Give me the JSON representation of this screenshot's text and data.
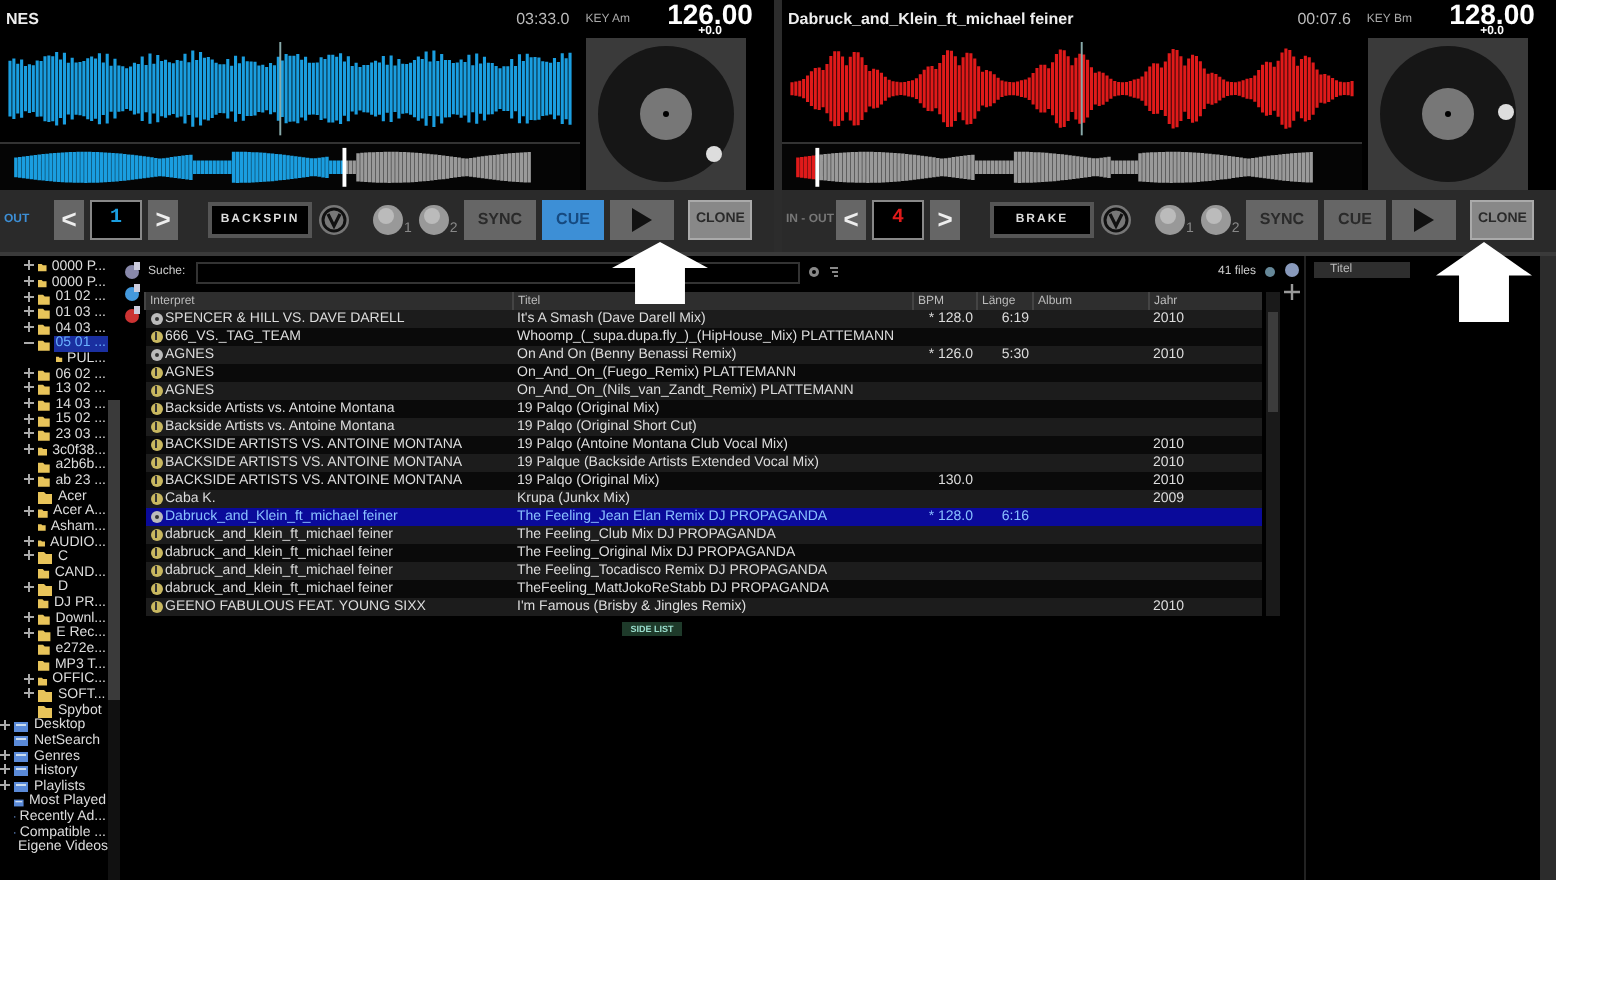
{
  "decks": [
    {
      "title": "NES",
      "time": "03:33.0",
      "key": "KEY Am",
      "bpm": "126.00",
      "pitch": "+0.0",
      "color": "#1a9ee0",
      "level": 0.62,
      "loop_label": "OUT",
      "prev": "<",
      "loop_value": "1",
      "next": ">",
      "effect": "BACKSPIN",
      "knobs": [
        "1",
        "2"
      ],
      "buttons": [
        {
          "kind": "text",
          "label": "SYNC",
          "active": false
        },
        {
          "kind": "text",
          "label": "CUE",
          "active": true
        },
        {
          "kind": "play",
          "active": false
        },
        {
          "kind": "text",
          "label": "CLONE",
          "active": false
        }
      ]
    },
    {
      "title": "Dabruck_and_Klein_ft_michael feiner",
      "time": "00:07.6",
      "key": "KEY Bm",
      "bpm": "128.00",
      "pitch": "+0.0",
      "color": "#e01a1a",
      "level": 0.03,
      "loop_label": "IN - OUT",
      "prev": "<",
      "loop_value": "4",
      "next": ">",
      "effect": "BRAKE",
      "knobs": [
        "1",
        "2"
      ],
      "buttons": [
        {
          "kind": "text",
          "label": "SYNC",
          "active": false
        },
        {
          "kind": "text",
          "label": "CUE",
          "active": false
        },
        {
          "kind": "play",
          "active": false
        },
        {
          "kind": "text",
          "label": "CLONE",
          "active": false
        }
      ]
    }
  ],
  "sidebar": {
    "folders": [
      {
        "label": "0000 P...",
        "kind": "collapsed",
        "selected": false
      },
      {
        "label": "0000 P...",
        "kind": "collapsed",
        "selected": false
      },
      {
        "label": "01 02 ...",
        "kind": "collapsed",
        "selected": false
      },
      {
        "label": "01 03 ...",
        "kind": "collapsed",
        "selected": false
      },
      {
        "label": "04 03 ...",
        "kind": "collapsed",
        "selected": false
      },
      {
        "label": "05 01 ...",
        "kind": "expanded",
        "selected": true,
        "children": [
          {
            "label": "PUL...",
            "selected": false
          }
        ]
      },
      {
        "label": "06 02 ...",
        "kind": "collapsed",
        "selected": false
      },
      {
        "label": "13 02 ...",
        "kind": "collapsed",
        "selected": false
      },
      {
        "label": "14 03 ...",
        "kind": "collapsed",
        "selected": false
      },
      {
        "label": "15 02 ...",
        "kind": "collapsed",
        "selected": false
      },
      {
        "label": "23 03 ...",
        "kind": "collapsed",
        "selected": false
      },
      {
        "label": "3c0f38...",
        "kind": "collapsed",
        "selected": false
      },
      {
        "label": "a2b6b...",
        "kind": "leaf",
        "selected": false
      },
      {
        "label": "ab 23 ...",
        "kind": "collapsed",
        "selected": false
      },
      {
        "label": "Acer",
        "kind": "leaf",
        "selected": false
      },
      {
        "label": "Acer A...",
        "kind": "collapsed",
        "selected": false
      },
      {
        "label": "Asham...",
        "kind": "leaf",
        "selected": false
      },
      {
        "label": "AUDIO...",
        "kind": "collapsed",
        "selected": false
      },
      {
        "label": "C",
        "kind": "collapsed",
        "selected": false
      },
      {
        "label": "CAND...",
        "kind": "leaf",
        "selected": false
      },
      {
        "label": "D",
        "kind": "collapsed",
        "selected": false
      },
      {
        "label": "DJ PR...",
        "kind": "leaf",
        "selected": false
      },
      {
        "label": "Downl...",
        "kind": "collapsed",
        "selected": false
      },
      {
        "label": "E Rec...",
        "kind": "collapsed",
        "selected": false
      },
      {
        "label": "e272e...",
        "kind": "leaf",
        "selected": false
      },
      {
        "label": "MP3 T...",
        "kind": "leaf",
        "selected": false
      },
      {
        "label": "OFFIC...",
        "kind": "collapsed",
        "selected": false
      },
      {
        "label": "SOFT...",
        "kind": "collapsed",
        "selected": false
      },
      {
        "label": "Spybot",
        "kind": "leaf",
        "selected": false
      }
    ],
    "places": [
      {
        "label": "Desktop",
        "kind": "collapsed",
        "selected": false
      },
      {
        "label": "NetSearch",
        "kind": "leaf",
        "selected": false
      },
      {
        "label": "Genres",
        "kind": "collapsed",
        "selected": false
      },
      {
        "label": "History",
        "kind": "collapsed",
        "selected": false
      },
      {
        "label": "Playlists",
        "kind": "collapsed",
        "selected": false
      },
      {
        "label": "Most Played",
        "kind": "leaf",
        "selected": false
      },
      {
        "label": "Recently Ad...",
        "kind": "leaf",
        "selected": false
      },
      {
        "label": "Compatible ...",
        "kind": "leaf",
        "selected": false
      },
      {
        "label": "Eigene Videos",
        "kind": "leaf",
        "selected": false
      }
    ]
  },
  "browser": {
    "search_label": "Suche:",
    "file_count": "41 files",
    "side_list_button": "SIDE LIST",
    "columns": [
      "Interpret",
      "Titel",
      "BPM",
      "Länge",
      "Album",
      "Jahr"
    ],
    "rows": [
      {
        "kind": "disc",
        "selected": false,
        "cells": [
          "SPENCER & HILL VS. DAVE DARELL",
          "It's A Smash (Dave Darell Mix)",
          "* 128.0",
          "6:19",
          "",
          "2010"
        ]
      },
      {
        "kind": "note",
        "selected": false,
        "cells": [
          "666_VS._TAG_TEAM",
          "Whoomp_(_supa.dupa.fly_)_(HipHouse_Mix)  PLATTEMANN",
          "",
          "",
          "",
          ""
        ]
      },
      {
        "kind": "disc",
        "selected": false,
        "cells": [
          "AGNES",
          "On And On (Benny Benassi Remix)",
          "* 126.0",
          "5:30",
          "",
          "2010"
        ]
      },
      {
        "kind": "note",
        "selected": false,
        "cells": [
          "AGNES",
          "On_And_On_(Fuego_Remix)  PLATTEMANN",
          "",
          "",
          "",
          ""
        ]
      },
      {
        "kind": "note",
        "selected": false,
        "cells": [
          "AGNES",
          "On_And_On_(Nils_van_Zandt_Remix)  PLATTEMANN",
          "",
          "",
          "",
          ""
        ]
      },
      {
        "kind": "note",
        "selected": false,
        "cells": [
          "Backside Artists vs. Antoine Montana",
          "19 Palqo (Original Mix)",
          "",
          "",
          "",
          ""
        ]
      },
      {
        "kind": "note",
        "selected": false,
        "cells": [
          "Backside Artists vs. Antoine Montana",
          "19 Palqo (Original Short Cut)",
          "",
          "",
          "",
          ""
        ]
      },
      {
        "kind": "note",
        "selected": false,
        "cells": [
          "BACKSIDE ARTISTS VS. ANTOINE MONTANA",
          "19 Palqo (Antoine Montana Club Vocal Mix)",
          "",
          "",
          "",
          "2010"
        ]
      },
      {
        "kind": "note",
        "selected": false,
        "cells": [
          "BACKSIDE ARTISTS VS. ANTOINE MONTANA",
          "19 Palque (Backside Artists Extended Vocal Mix)",
          "",
          "",
          "",
          "2010"
        ]
      },
      {
        "kind": "note",
        "selected": false,
        "cells": [
          "BACKSIDE ARTISTS VS. ANTOINE MONTANA",
          "19 Palqo (Original Mix)",
          "130.0",
          "",
          "",
          "2010"
        ]
      },
      {
        "kind": "note",
        "selected": false,
        "cells": [
          "Caba K.",
          "Krupa (Junkx Mix)",
          "",
          "",
          "",
          "2009"
        ]
      },
      {
        "kind": "disc",
        "selected": true,
        "cells": [
          "Dabruck_and_Klein_ft_michael feiner",
          "The Feeling_Jean Elan Remix DJ PROPAGANDA",
          "* 128.0",
          "6:16",
          "",
          ""
        ]
      },
      {
        "kind": "note",
        "selected": false,
        "cells": [
          "dabruck_and_klein_ft_michael feiner",
          "The Feeling_Club Mix  DJ PROPAGANDA",
          "",
          "",
          "",
          ""
        ]
      },
      {
        "kind": "note",
        "selected": false,
        "cells": [
          "dabruck_and_klein_ft_michael feiner",
          "The Feeling_Original Mix DJ PROPAGANDA",
          "",
          "",
          "",
          ""
        ]
      },
      {
        "kind": "note",
        "selected": false,
        "cells": [
          "dabruck_and_klein_ft_michael feiner",
          "The Feeling_Tocadisco Remix DJ PROPAGANDA",
          "",
          "",
          "",
          ""
        ]
      },
      {
        "kind": "note",
        "selected": false,
        "cells": [
          "dabruck_and_klein_ft_michael feiner",
          "TheFeeling_MattJokoReStabb DJ PROPAGANDA",
          "",
          "",
          "",
          ""
        ]
      },
      {
        "kind": "note",
        "selected": false,
        "cells": [
          "GEENO FABULOUS FEAT. YOUNG SIXX",
          "I'm Famous (Brisby & Jingles Remix)",
          "",
          "",
          "",
          "2010"
        ]
      }
    ]
  },
  "side_panel": {
    "column": "Titel"
  }
}
